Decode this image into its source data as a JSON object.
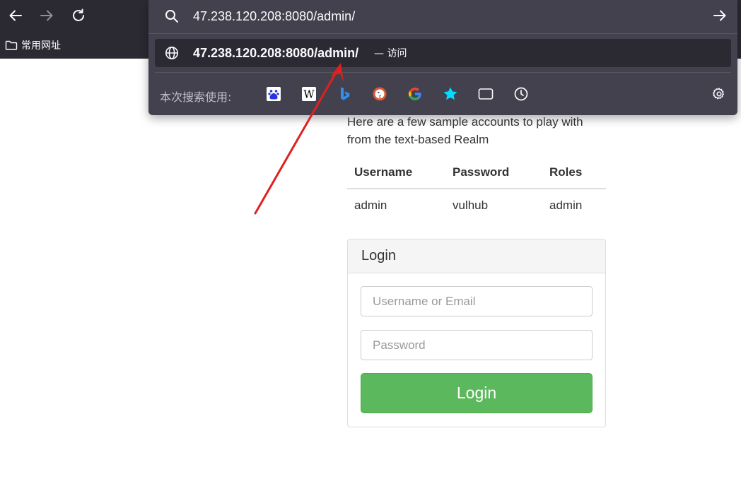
{
  "browser": {
    "bookmark_label": "常用网址",
    "url_input_value": "47.238.120.208:8080/admin/",
    "suggestion_url": "47.238.120.208:8080/admin/",
    "suggestion_action": "— 访问",
    "search_engines_label": "本次搜索使用:",
    "engines": [
      "baidu",
      "wikipedia",
      "bing",
      "duckduckgo",
      "google",
      "bookmarks",
      "tabs",
      "history"
    ]
  },
  "page": {
    "intro_text": "Here are a few sample accounts to play with from the text-based Realm",
    "table": {
      "headers": [
        "Username",
        "Password",
        "Roles"
      ],
      "rows": [
        [
          "admin",
          "vulhub",
          "admin"
        ]
      ]
    },
    "login": {
      "panel_title": "Login",
      "username_placeholder": "Username or Email",
      "password_placeholder": "Password",
      "button_label": "Login"
    }
  },
  "colors": {
    "chrome_bg": "#2b2a33",
    "panel_bg": "#42414d",
    "login_button": "#5cb85c",
    "annotation_arrow": "#e02020"
  }
}
